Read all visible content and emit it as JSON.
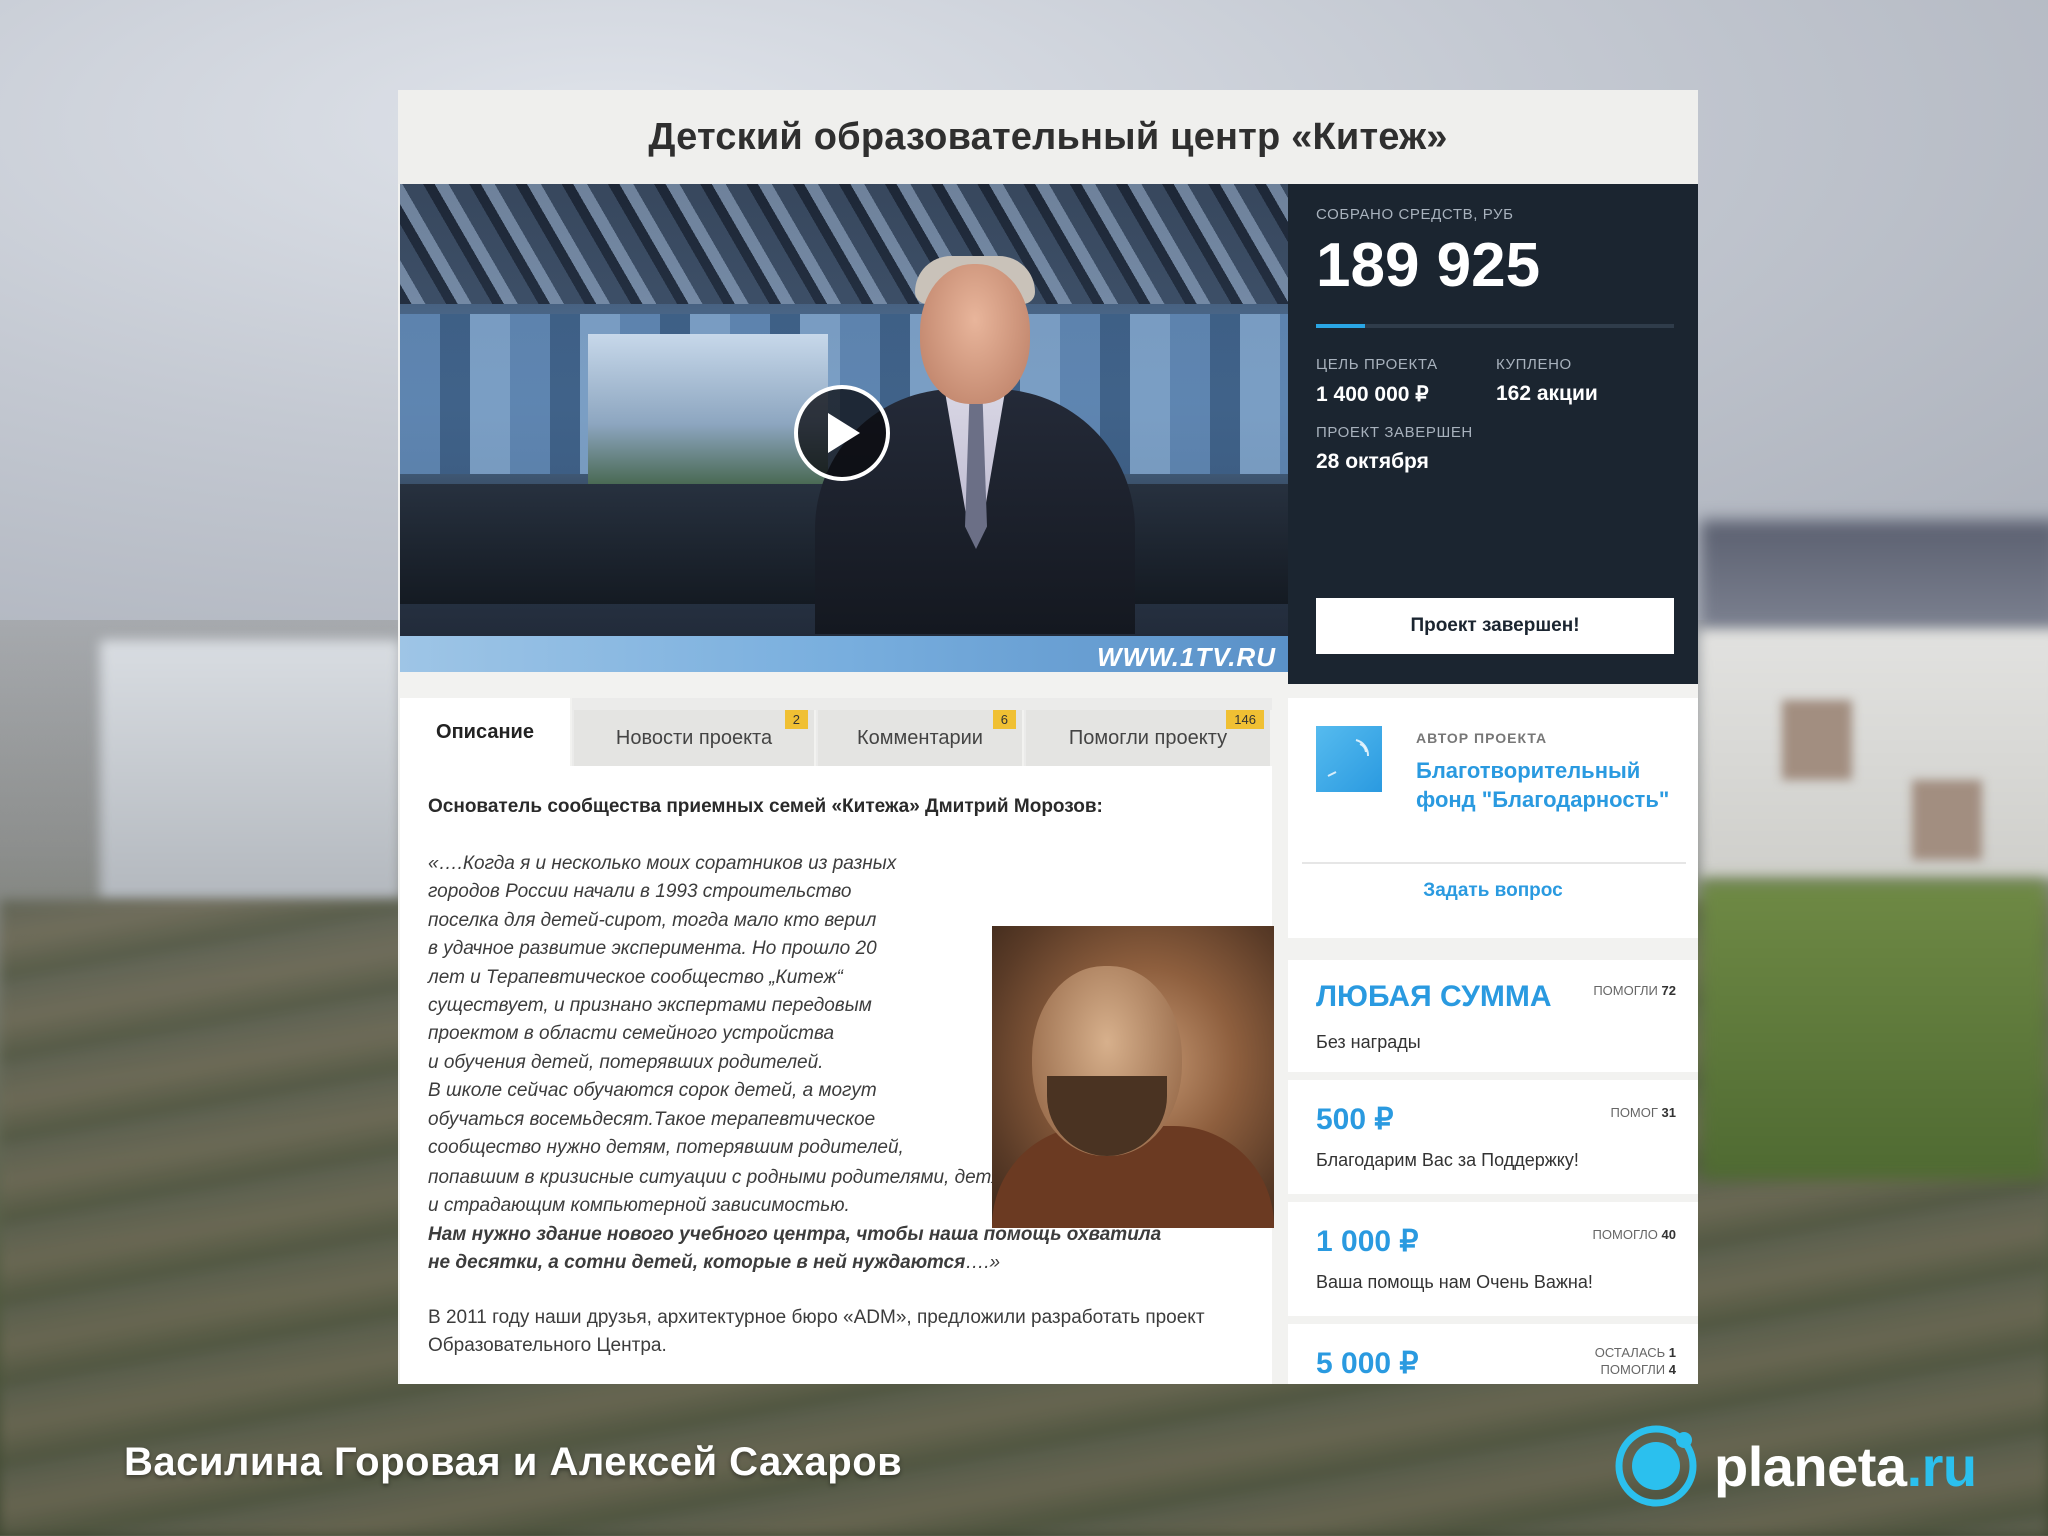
{
  "project": {
    "title": "Детский образовательный центр «Китеж»"
  },
  "video": {
    "watermark": "WWW.1TV.RU",
    "play_icon": "play-icon"
  },
  "stats": {
    "collected_label": "СОБРАНО СРЕДСТВ, РУБ",
    "collected_value": "189 925",
    "progress_fraction": 0.136,
    "goal_label": "ЦЕЛЬ ПРОЕКТА",
    "goal_value": "1 400 000 ₽",
    "bought_label": "КУПЛЕНО",
    "bought_value": "162 акции",
    "finished_label": "ПРОЕКТ ЗАВЕРШЕН",
    "finished_value": "28 октября",
    "finished_button": "Проект завершен!"
  },
  "tabs": [
    {
      "label": "Описание",
      "badge": ""
    },
    {
      "label": "Новости проекта",
      "badge": "2"
    },
    {
      "label": "Комментарии",
      "badge": "6"
    },
    {
      "label": "Помогли проекту",
      "badge": "146"
    }
  ],
  "article": {
    "lead": "Основатель сообщества приемных семей «Китежа» Дмитрий Морозов:",
    "quote_lines": [
      "«….Когда я и несколько моих соратников из разных",
      "городов России начали в 1993 строительство",
      "поселка для детей-сирот, тогда мало кто верил",
      "в удачное развитие эксперимента. Но прошло 20",
      "лет и Терапевтическое сообщество „Китеж“",
      "существует, и признано экспертами передовым",
      "проектом в области семейного устройства",
      "и обучения детей, потерявших родителей.",
      "В школе сейчас обучаются сорок детей, а могут",
      "обучаться восемьдесят.Такое терапевтическое",
      "сообщество нужно детям, потерявшим родителей,"
    ],
    "quote_tail_lines": [
      "попавшим в кризисные ситуации с родными родителями, детям, бросившим школу",
      "и страдающим компьютерной зависимостью."
    ],
    "quote_bold_lines": [
      "Нам нужно здание нового учебного центра, чтобы наша помощь охватила",
      "не десятки, а сотни детей, которые в ней нуждаются"
    ],
    "quote_end": "….»",
    "paragraph_lines": [
      "В 2011 году наши друзья, архитектурное бюро «ADM», предложили разработать проект",
      "Образовательного Центра."
    ]
  },
  "author": {
    "label": "АВТОР ПРОЕКТА",
    "name": "Благотворительный фонд \"Благодарность\"",
    "ask_button": "Задать вопрос"
  },
  "rewards": [
    {
      "amount": "ЛЮБАЯ СУММА",
      "desc": "Без награды",
      "meta_label": "ПОМОГЛИ",
      "meta_value": "72"
    },
    {
      "amount": "500 ₽",
      "desc": "Благодарим Вас за Поддержку!",
      "meta_label": "ПОМОГ",
      "meta_value": "31"
    },
    {
      "amount": "1 000 ₽",
      "desc": "Ваша помощь нам Очень Важна!",
      "meta_label": "ПОМОГЛО",
      "meta_value": "40"
    },
    {
      "amount": "5 000 ₽",
      "desc": "",
      "meta_label": "ОСТАЛАСЬ",
      "meta_value": "1",
      "meta_label2": "ПОМОГЛИ",
      "meta_value2": "4"
    }
  ],
  "footer": {
    "authors": "Василина Горовая и Алексей Сахаров",
    "brand_name": "planeta",
    "brand_tld": ".ru",
    "brand_color": "#2bc0ee"
  }
}
